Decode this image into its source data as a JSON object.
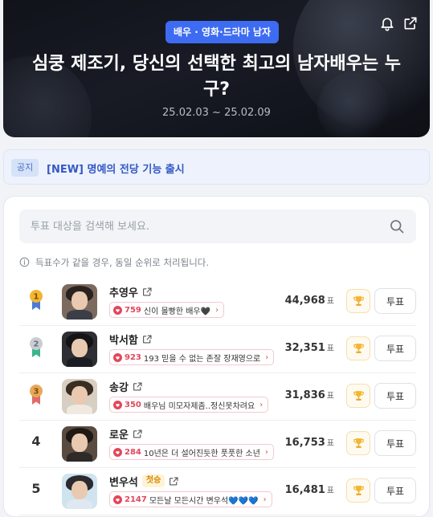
{
  "header": {
    "category": "배우 · 영화·드라마 남자",
    "title": "심쿵 제조기, 당신의 선택한 최고의 남자배우는 누구?",
    "period": "25.02.03 ~ 25.02.09",
    "icons": [
      "bell-icon",
      "share-icon"
    ]
  },
  "notice": {
    "tag": "공지",
    "text": "[NEW] 명예의 전당 기능 출시"
  },
  "search": {
    "placeholder": "투표 대상을 검색해 보세요."
  },
  "tie_notice": "득표수가 같을 경우, 동일 순위로 처리됩니다.",
  "vote_unit": "표",
  "vote_label": "투표",
  "rising_label": "첫승",
  "candidates": [
    {
      "rank": "1",
      "name": "추영우",
      "comment_count": "759",
      "comment": "신이 몰빵한 배우🖤",
      "votes": "44,968",
      "medal": "gold"
    },
    {
      "rank": "2",
      "name": "박서함",
      "comment_count": "923",
      "comment": "193 믿을 수 없는 존잘 장재영으로",
      "votes": "32,351",
      "medal": "silver"
    },
    {
      "rank": "3",
      "name": "송강",
      "comment_count": "350",
      "comment": "배우님 미모자제좀..정신못차려요",
      "votes": "31,836",
      "medal": "bronze"
    },
    {
      "rank": "4",
      "name": "로운",
      "comment_count": "284",
      "comment": "10년은 더 설어진듯한 풋풋한 소년",
      "votes": "16,753"
    },
    {
      "rank": "5",
      "name": "변우석",
      "comment_count": "2147",
      "comment": "모든날 모든시간 변우석💙💙💙",
      "votes": "16,481",
      "rising": true
    }
  ],
  "colors": {
    "accent": "#3d6bf2",
    "notice_text": "#3558c6",
    "comment_accent": "#e3465b",
    "medal_gold": "#f2b632",
    "medal_silver": "#c9cdd4",
    "medal_bronze": "#e8a85a"
  }
}
